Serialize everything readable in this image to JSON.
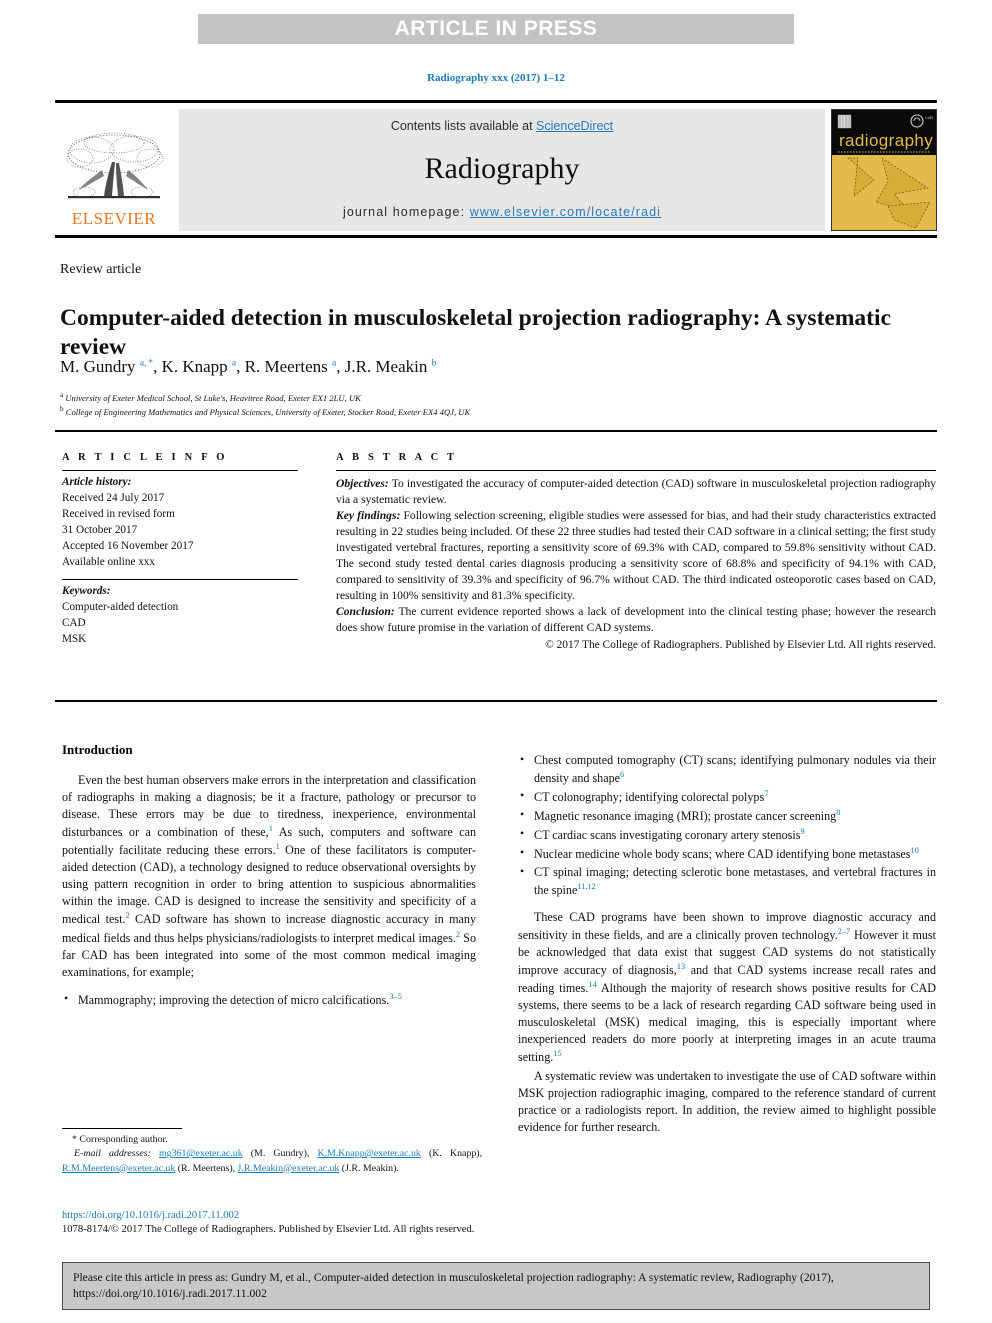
{
  "banner": {
    "text": "ARTICLE IN PRESS"
  },
  "journal_ref": "Radiography xxx (2017) 1–12",
  "masthead": {
    "contents_prefix": "Contents lists available at ",
    "sciencedirect": "ScienceDirect",
    "journal_name": "Radiography",
    "homepage_prefix": "journal homepage: ",
    "homepage_url": "www.elsevier.com/locate/radi",
    "elsevier_wordmark": "ELSEVIER",
    "cover_title": "radiography",
    "accent_blue": "#2a7ab9",
    "elsevier_orange": "#e87722",
    "cover_gold": "#e3bb4c",
    "banner_grey": "#c3c3c3"
  },
  "article": {
    "type_label": "Review article",
    "title": "Computer-aided detection in musculoskeletal projection radiography: A systematic review",
    "authors_html": "M. Gundry <sup>a, *</sup>, K. Knapp <sup>a</sup>, R. Meertens <sup>a</sup>, J.R. Meakin <sup>b</sup>",
    "affiliations": [
      {
        "marker": "a",
        "text": "University of Exeter Medical School, St Luke's, Heavitree Road, Exeter EX1 2LU, UK"
      },
      {
        "marker": "b",
        "text": "College of Engineering Mathematics and Physical Sciences, University of Exeter, Stocker Road, Exeter EX4 4QJ, UK"
      }
    ]
  },
  "article_info": {
    "heading": "A R T I C L E   I N F O",
    "history_label": "Article history:",
    "history": [
      "Received 24 July 2017",
      "Received in revised form",
      "31 October 2017",
      "Accepted 16 November 2017",
      "Available online xxx"
    ],
    "keywords_label": "Keywords:",
    "keywords": [
      "Computer-aided detection",
      "CAD",
      "MSK"
    ]
  },
  "abstract": {
    "heading": "A B S T R A C T",
    "objectives_label": "Objectives:",
    "objectives_text": " To investigated the accuracy of computer-aided detection (CAD) software in musculoskeletal projection radiography via a systematic review.",
    "key_findings_label": "Key findings:",
    "key_findings_text": " Following selection screening, eligible studies were assessed for bias, and had their study characteristics extracted resulting in 22 studies being included. Of these 22 three studies had tested their CAD software in a clinical setting; the first study investigated vertebral fractures, reporting a sensitivity score of 69.3% with CAD, compared to 59.8% sensitivity without CAD. The second study tested dental caries diagnosis producing a sensitivity score of 68.8% and specificity of 94.1% with CAD, compared to sensitivity of 39.3% and specificity of 96.7% without CAD. The third indicated osteoporotic cases based on CAD, resulting in 100% sensitivity and 81.3% specificity.",
    "conclusion_label": "Conclusion:",
    "conclusion_text": " The current evidence reported shows a lack of development into the clinical testing phase; however the research does show future promise in the variation of different CAD systems.",
    "copyright": "© 2017 The College of Radiographers. Published by Elsevier Ltd. All rights reserved."
  },
  "body": {
    "intro_heading": "Introduction",
    "left_paragraphs": [
      "Even the best human observers make errors in the interpretation and classification of radiographs in making a diagnosis; be it a fracture, pathology or precursor to disease. These errors may be due to tiredness, inexperience, environmental disturbances or a combination of these,<sup>1</sup> As such, computers and software can potentially facilitate reducing these errors.<sup>1</sup> One of these facilitators is computer-aided detection (CAD), a technology designed to reduce observational oversights by using pattern recognition in order to bring attention to suspicious abnormalities within the image. CAD is designed to increase the sensitivity and specificity of a medical test.<sup>2</sup> CAD software has shown to increase diagnostic accuracy in many medical fields and thus helps physicians/radiologists to interpret medical images.<sup>2</sup> So far CAD has been integrated into some of the most common medical imaging examinations, for example;"
    ],
    "left_bullets": [
      "Mammography; improving the detection of micro calcifications.<sup>3&#8211;5</sup>"
    ],
    "right_bullets": [
      "Chest computed tomography (CT) scans; identifying pulmonary nodules via their density and shape<sup>6</sup>",
      "CT colonography; identifying colorectal polyps<sup>7</sup>",
      "Magnetic resonance imaging (MRI); prostate cancer screening<sup>8</sup>",
      "CT cardiac scans investigating coronary artery stenosis<sup>9</sup>",
      "Nuclear medicine whole body scans; where CAD identifying bone metastases<sup>10</sup>",
      "CT spinal imaging; detecting sclerotic bone metastases, and vertebral fractures in the spine<sup>11,12</sup>"
    ],
    "right_paragraphs": [
      "These CAD programs have been shown to improve diagnostic accuracy and sensitivity in these fields, and are a clinically proven technology.<sup>2&#8211;7</sup> However it must be acknowledged that data exist that suggest CAD systems do not statistically improve accuracy of diagnosis,<sup>13</sup> and that CAD systems increase recall rates and reading times.<sup>14</sup> Although the majority of research shows positive results for CAD systems, there seems to be a lack of research regarding CAD software being used in musculoskeletal (MSK) medical imaging, this is especially important where inexperienced readers do more poorly at interpreting images in an acute trauma setting.<sup>15</sup>",
      "A systematic review was undertaken to investigate the use of CAD software within MSK projection radiographic imaging, compared to the reference standard of current practice or a radiologists report. In addition, the review aimed to highlight possible evidence for further research."
    ]
  },
  "footnotes": {
    "corresponding": "* Corresponding author.",
    "email_label": "E-mail addresses:",
    "emails": [
      {
        "address": "mg361@exeter.ac.uk",
        "name": "(M. Gundry),"
      },
      {
        "address": "K.M.Knapp@exeter.ac.uk",
        "name": "(K. Knapp),"
      },
      {
        "address": "R.M.Meertens@exeter.ac.uk",
        "name": "(R. Meertens),"
      },
      {
        "address": "J.R.Meakin@exeter.ac.uk",
        "name": "(J.R. Meakin)."
      }
    ],
    "doi": "https://doi.org/10.1016/j.radi.2017.11.002",
    "issn": "1078-8174/© 2017 The College of Radiographers. Published by Elsevier Ltd. All rights reserved."
  },
  "cite_box": {
    "text": "Please cite this article in press as: Gundry M, et al., Computer-aided detection in musculoskeletal projection radiography: A systematic review, Radiography (2017), https://doi.org/10.1016/j.radi.2017.11.002"
  }
}
